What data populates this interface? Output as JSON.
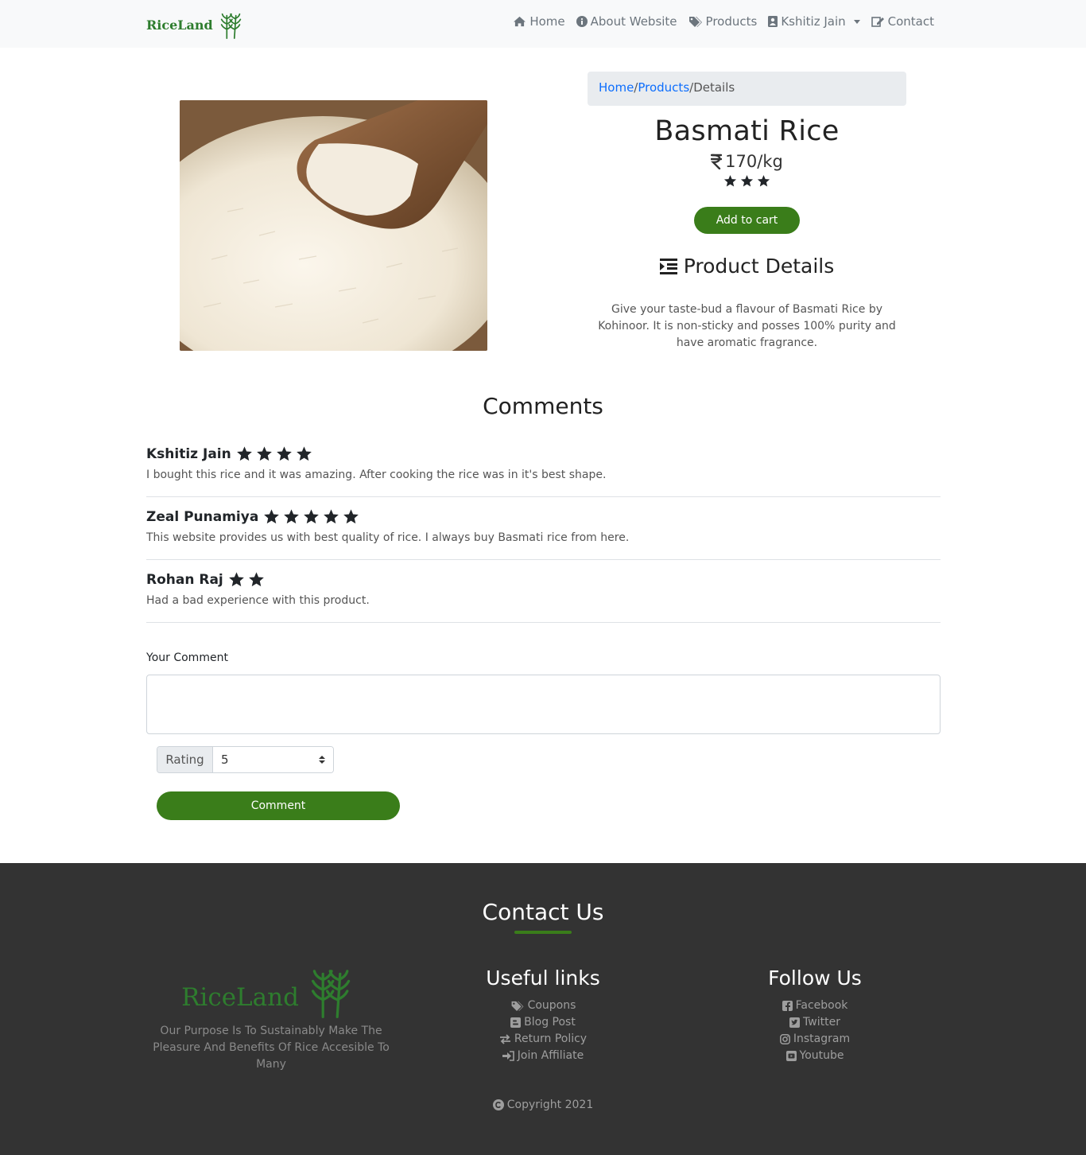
{
  "navbar": {
    "brand": "RiceLand",
    "links": [
      {
        "label": "Home",
        "icon": "home-icon"
      },
      {
        "label": "About Website",
        "icon": "info-icon"
      },
      {
        "label": "Products",
        "icon": "tags-icon"
      },
      {
        "label": "Kshitiz Jain",
        "icon": "user-icon",
        "dropdown": true
      },
      {
        "label": "Contact",
        "icon": "edit-icon"
      }
    ]
  },
  "breadcrumb": {
    "home": "Home",
    "products": "Products",
    "current": "Details",
    "sep": "/"
  },
  "product": {
    "title": "Basmati Rice",
    "price": "170/kg",
    "currency_icon": "rupee-icon",
    "rating": 3,
    "add_to_cart": "Add to cart",
    "details_heading": "Product Details",
    "description": "Give your taste-bud a flavour of Basmati Rice by Kohinoor. It is non-sticky and posses 100% purity and have aromatic fragrance."
  },
  "comments": {
    "title": "Comments",
    "items": [
      {
        "name": "Kshitiz Jain",
        "rating": 4,
        "text": "I bought this rice and it was amazing. After cooking the rice was in it's best shape."
      },
      {
        "name": "Zeal Punamiya",
        "rating": 5,
        "text": "This website provides us with best quality of rice. I always buy Basmati rice from here."
      },
      {
        "name": "Rohan Raj",
        "rating": 2,
        "text": "Had a bad experience with this product."
      }
    ]
  },
  "form": {
    "label": "Your Comment",
    "textarea_value": "",
    "rating_label": "Rating",
    "rating_value": "5",
    "submit": "Comment"
  },
  "footer": {
    "title": "Contact Us",
    "brand": "RiceLand",
    "purpose": "Our Purpose Is To Sustainably Make The Pleasure And Benefits Of Rice Accesible To Many",
    "useful_links": {
      "title": "Useful links",
      "items": [
        "Coupons",
        "Blog Post",
        "Return Policy",
        "Join Affiliate"
      ]
    },
    "follow_us": {
      "title": "Follow Us",
      "items": [
        "Facebook",
        "Twitter",
        "Instagram",
        "Youtube"
      ]
    },
    "copyright": "Copyright 2021"
  },
  "colors": {
    "accent_green": "#3a7d1a",
    "brand_green": "#2e7d2e",
    "footer_bg": "#333333"
  }
}
